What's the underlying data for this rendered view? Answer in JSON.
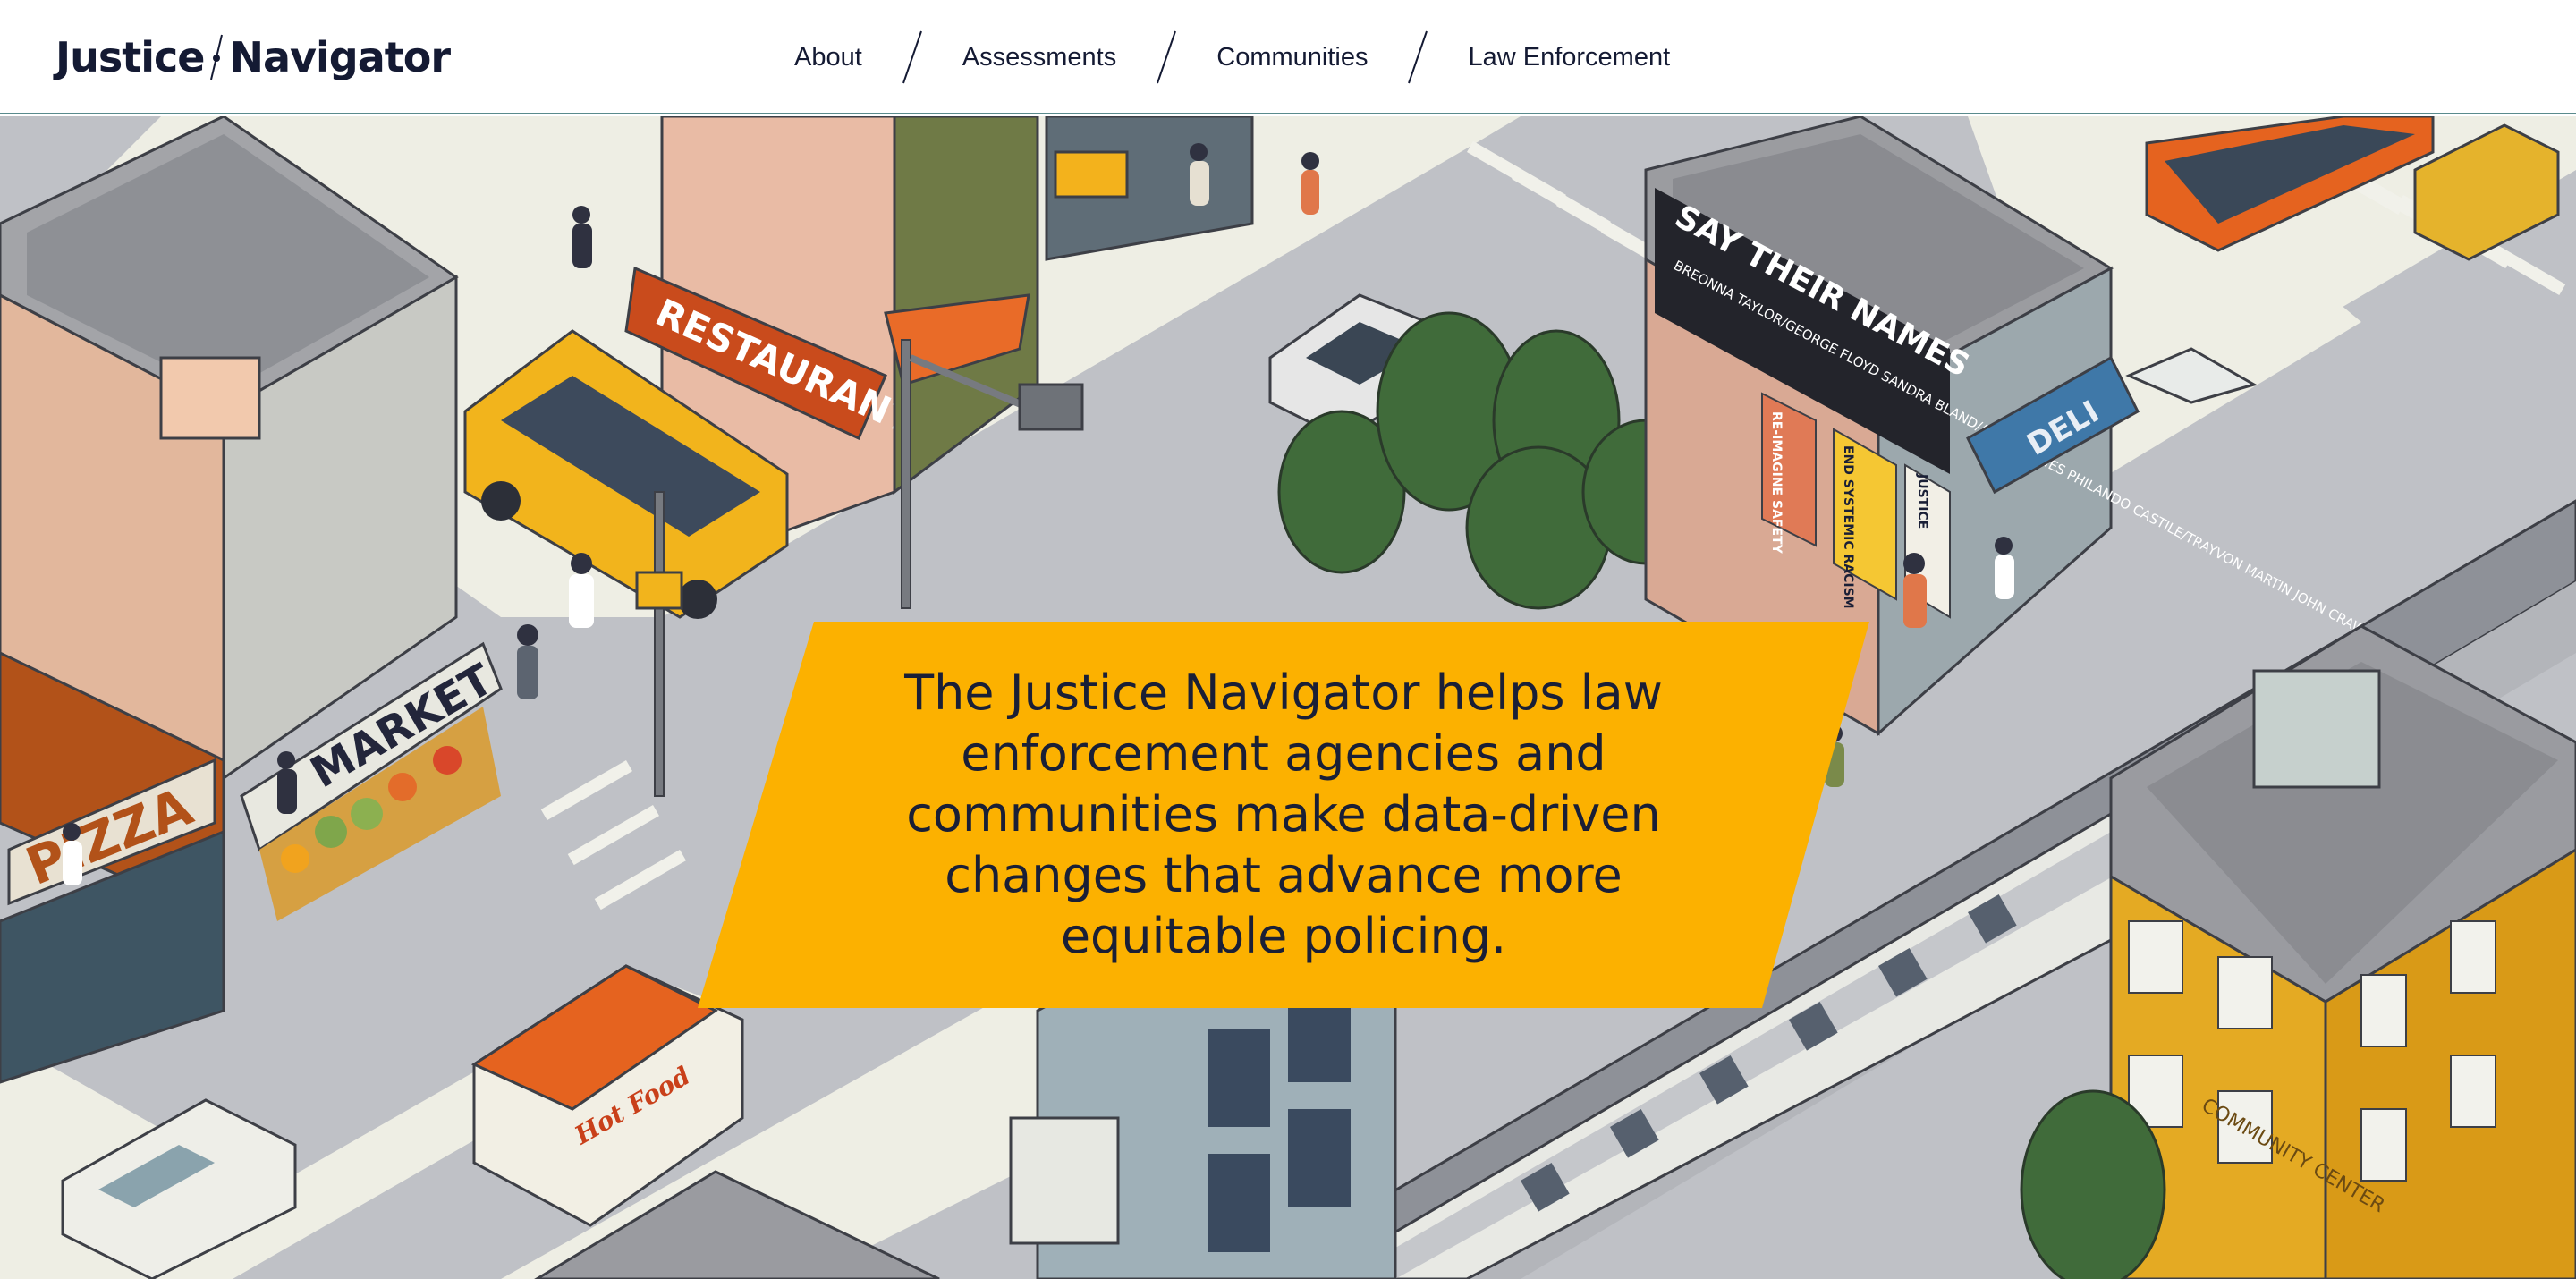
{
  "header": {
    "logo": {
      "word1": "Justice",
      "word2": "Navigator"
    },
    "nav": [
      {
        "label": "About"
      },
      {
        "label": "Assessments"
      },
      {
        "label": "Communities"
      },
      {
        "label": "Law Enforcement"
      }
    ]
  },
  "hero": {
    "tagline": "The Justice Navigator helps law enforcement agencies and communities make data-driven changes that advance more equitable policing.",
    "illustration": {
      "signs": {
        "restaurant": "RESTAURANT",
        "market": "MARKET",
        "pizza": "PIZZA",
        "deli": "DELI",
        "hot_food": "Hot Food",
        "community_center": "COMMUNITY CENTER",
        "mural_title": "SAY THEIR NAMES",
        "mural_names": "BREONNA TAYLOR/GEORGE FLOYD SANDRA BLAND/AIYANA JONES PHILANDO CASTILE/TRAYVON MARTIN JOHN CRAWFORD III",
        "poster_safety": "RE-IMAGINE SAFETY",
        "poster_racism": "END SYSTEMIC RACISM",
        "poster_justice": "JUSTICE"
      }
    },
    "colors": {
      "banner": "#fcb100",
      "text": "#1a1f36",
      "road": "#bfc1c6",
      "sidewalk": "#eeeee4",
      "header_border": "#5a8b8d"
    }
  }
}
